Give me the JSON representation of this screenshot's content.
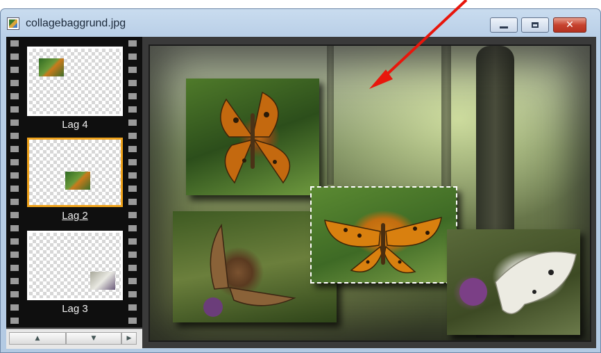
{
  "window": {
    "title": "collagebaggrund.jpg",
    "icon": "image-file-icon",
    "controls": {
      "minimize": "minimize-icon",
      "maximize": "maximize-icon",
      "close": "close-icon"
    }
  },
  "layers_strip": {
    "layers": [
      {
        "label": "Lag 4",
        "selected": false
      },
      {
        "label": "Lag 2",
        "selected": true
      },
      {
        "label": "Lag 3",
        "selected": false
      }
    ],
    "selected_border_color": "#f0a31c"
  },
  "scrollbar": {
    "up": "▲",
    "down": "▼",
    "right": "▶"
  },
  "canvas": {
    "photos": [
      "comma-butterfly-photo",
      "fritillary-on-thistle-photo",
      "silver-washed-fritillary-photo",
      "white-butterfly-photo"
    ],
    "selected_photo": "silver-washed-fritillary-photo"
  },
  "annotation": {
    "arrow_color": "#e8160c"
  }
}
